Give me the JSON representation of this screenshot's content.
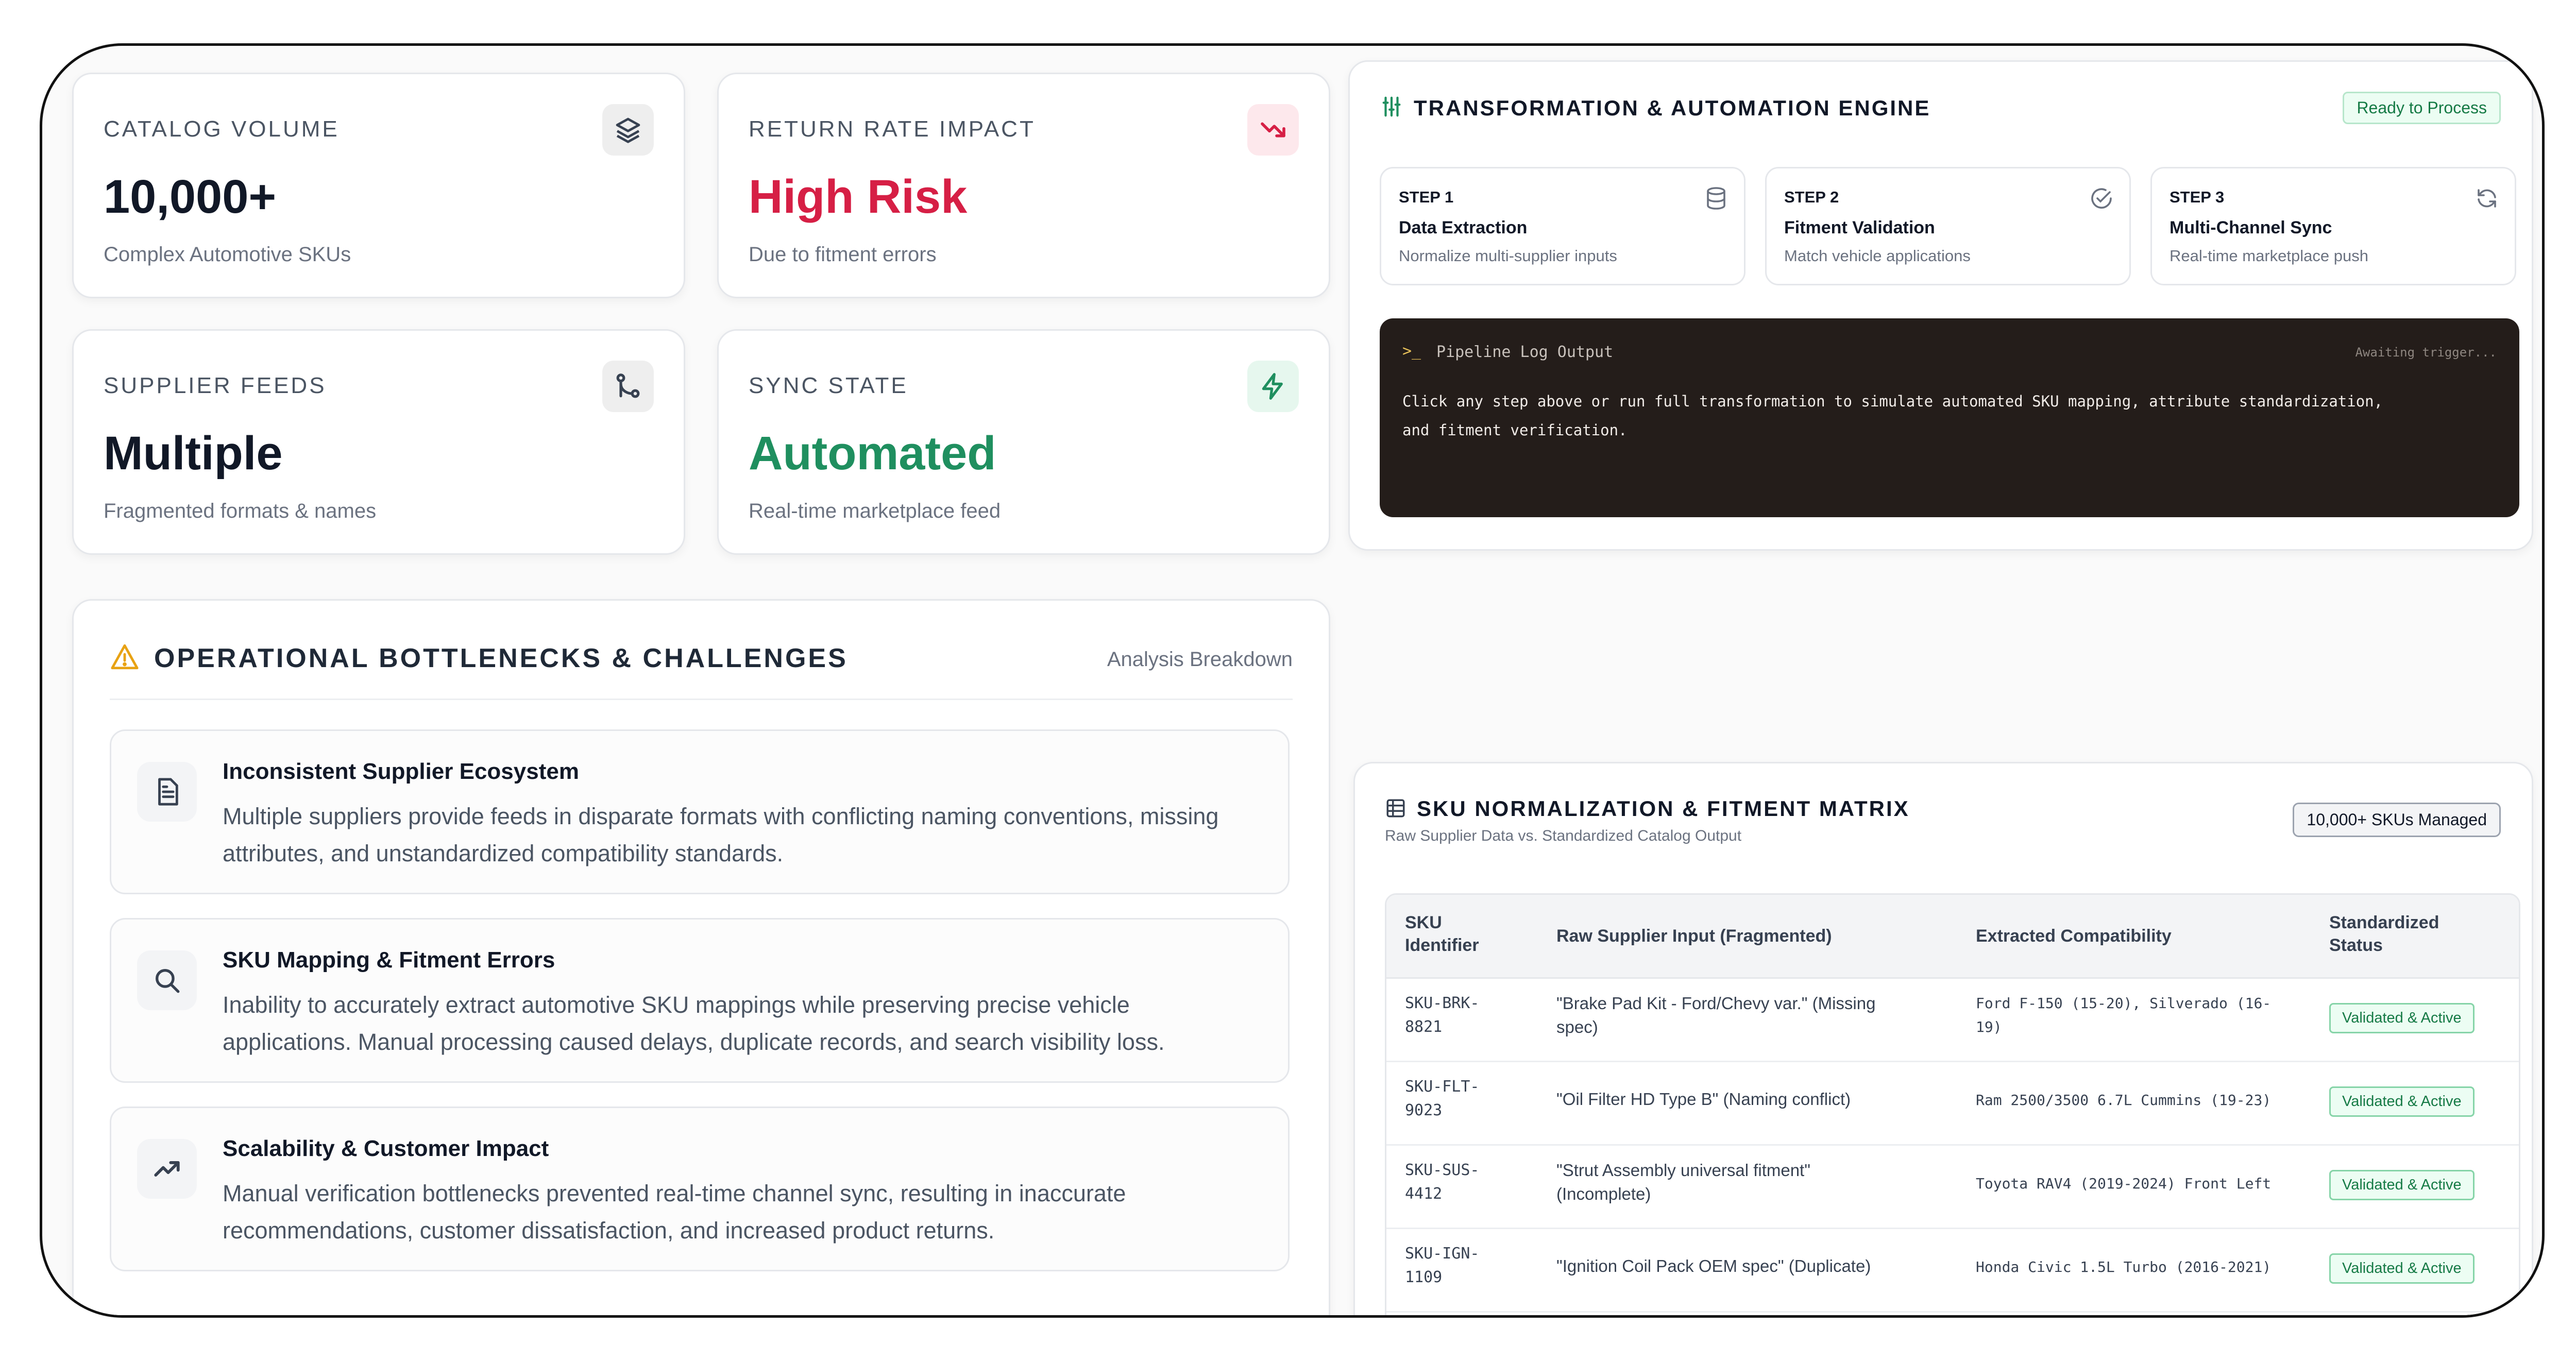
{
  "stats": [
    {
      "label": "CATALOG VOLUME",
      "value": "10,000+",
      "sub": "Complex Automotive SKUs",
      "icon": "layers-icon",
      "value_color": "#111827",
      "icon_bg": "#eeeeee",
      "icon_color": "#374151"
    },
    {
      "label": "RETURN RATE IMPACT",
      "value": "High Risk",
      "sub": "Due to fitment errors",
      "icon": "trending-down-icon",
      "value_color": "#d61f45",
      "icon_bg": "#fde8ec",
      "icon_color": "#d61f45"
    },
    {
      "label": "SUPPLIER FEEDS",
      "value": "Multiple",
      "sub": "Fragmented formats & names",
      "icon": "git-merge-icon",
      "value_color": "#111827",
      "icon_bg": "#eeeeee",
      "icon_color": "#374151"
    },
    {
      "label": "SYNC STATE",
      "value": "Automated",
      "sub": "Real-time marketplace feed",
      "icon": "lightning-icon",
      "value_color": "#1f8f5f",
      "icon_bg": "#e6f7ee",
      "icon_color": "#1f8f5f"
    }
  ],
  "challenges": {
    "title": "OPERATIONAL BOTTLENECKS & CHALLENGES",
    "meta": "Analysis Breakdown",
    "items": [
      {
        "title": "Inconsistent Supplier Ecosystem",
        "desc": "Multiple suppliers provide feeds in disparate formats with conflicting naming conventions, missing attributes, and unstandardized compatibility standards.",
        "icon": "document-icon"
      },
      {
        "title": "SKU Mapping & Fitment Errors",
        "desc": "Inability to accurately extract automotive SKU mappings while preserving precise vehicle applications. Manual processing caused delays, duplicate records, and search visibility loss.",
        "icon": "search-icon"
      },
      {
        "title": "Scalability & Customer Impact",
        "desc": "Manual verification bottlenecks prevented real-time channel sync, resulting in inaccurate recommendations, customer dissatisfaction, and increased product returns.",
        "icon": "trending-up-icon"
      }
    ]
  },
  "engine": {
    "title": "TRANSFORMATION & AUTOMATION ENGINE",
    "status": "Ready to Process",
    "steps": [
      {
        "num": "STEP 1",
        "title": "Data Extraction",
        "sub": "Normalize multi-supplier inputs",
        "icon": "database-icon"
      },
      {
        "num": "STEP 2",
        "title": "Fitment Validation",
        "sub": "Match vehicle applications",
        "icon": "check-circle-icon"
      },
      {
        "num": "STEP 3",
        "title": "Multi-Channel Sync",
        "sub": "Real-time marketplace push",
        "icon": "refresh-icon"
      }
    ],
    "log": {
      "prompt": ">_",
      "title": "Pipeline Log Output",
      "status": "Awaiting trigger...",
      "line1": "Click any step above or run full transformation to simulate automated SKU mapping, attribute standardization,",
      "line2": "and fitment verification."
    }
  },
  "matrix": {
    "title": "SKU NORMALIZATION & FITMENT MATRIX",
    "subtitle": "Raw Supplier Data vs. Standardized Catalog Output",
    "badge": "10,000+ SKUs Managed",
    "headers": {
      "sku1": "SKU",
      "sku2": "Identifier",
      "raw": "Raw Supplier Input (Fragmented)",
      "compat": "Extracted Compatibility",
      "std1": "Standardized",
      "std2": "Status"
    },
    "rows": [
      {
        "sku1": "SKU-BRK-",
        "sku2": "8821",
        "raw1": "\"Brake Pad Kit - Ford/Chevy var.\" (Missing",
        "raw2": "spec)",
        "compat1": "Ford F-150 (15-20), Silverado (16-",
        "compat2": "19)",
        "status": "Validated & Active"
      },
      {
        "sku1": "SKU-FLT-",
        "sku2": "9023",
        "raw1": "\"Oil Filter HD Type B\" (Naming conflict)",
        "raw2": "",
        "compat1": "Ram 2500/3500 6.7L Cummins (19-23)",
        "compat2": "",
        "status": "Validated & Active"
      },
      {
        "sku1": "SKU-SUS-",
        "sku2": "4412",
        "raw1": "\"Strut Assembly universal fitment\"",
        "raw2": "(Incomplete)",
        "compat1": "Toyota RAV4 (2019-2024) Front Left",
        "compat2": "",
        "status": "Validated & Active"
      },
      {
        "sku1": "SKU-IGN-",
        "sku2": "1109",
        "raw1": "\"Ignition Coil Pack OEM spec\" (Duplicate)",
        "raw2": "",
        "compat1": "Honda Civic 1.5L Turbo (2016-2021)",
        "compat2": "",
        "status": "Validated & Active"
      }
    ]
  }
}
